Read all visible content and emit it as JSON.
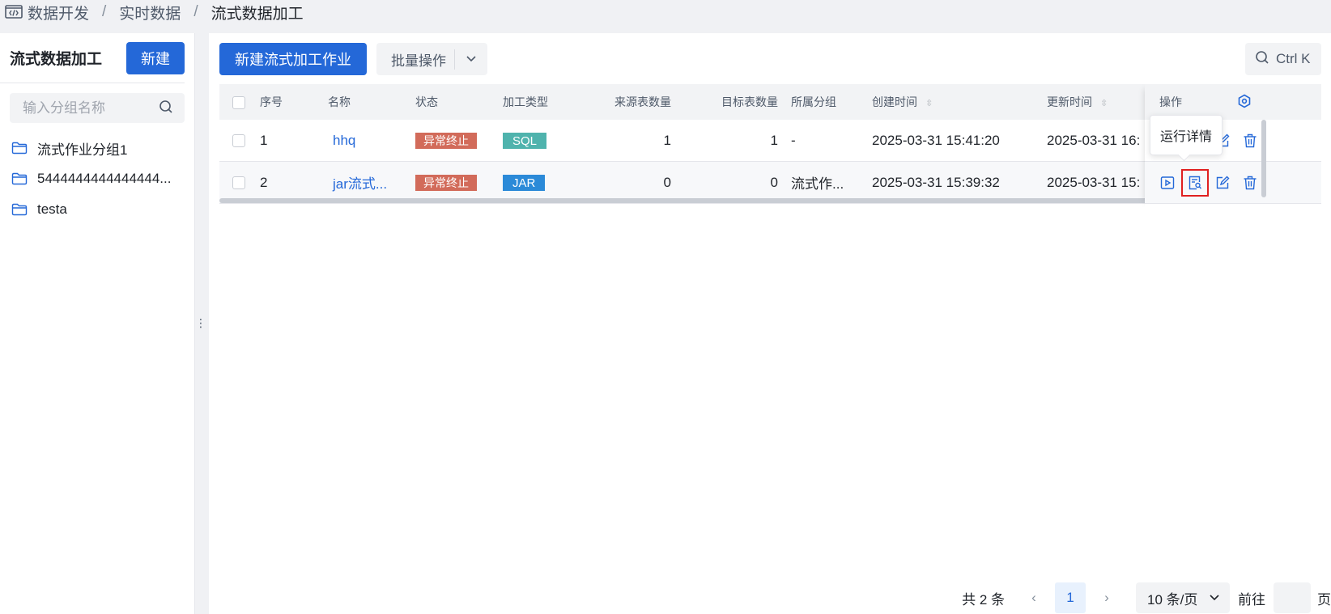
{
  "breadcrumb": {
    "items": [
      "数据开发",
      "实时数据",
      "流式数据加工"
    ],
    "separator": "/"
  },
  "sidebar": {
    "title": "流式数据加工",
    "new_label": "新建",
    "search_placeholder": "输入分组名称",
    "groups": [
      {
        "label": "流式作业分组1"
      },
      {
        "label": "5444444444444444..."
      },
      {
        "label": "testa"
      }
    ]
  },
  "toolbar": {
    "new_job_label": "新建流式加工作业",
    "batch_label": "批量操作",
    "shortcut_label": "Ctrl K"
  },
  "table": {
    "headers": {
      "index": "序号",
      "name": "名称",
      "status": "状态",
      "type": "加工类型",
      "source_count": "来源表数量",
      "target_count": "目标表数量",
      "group": "所属分组",
      "created": "创建时间",
      "updated": "更新时间",
      "ops": "操作"
    },
    "rows": [
      {
        "index": "1",
        "name": "hhq",
        "status": "异常终止",
        "type": "SQL",
        "source_count": "1",
        "target_count": "1",
        "group": "-",
        "created": "2025-03-31 15:41:20",
        "updated": "2025-03-31 16:"
      },
      {
        "index": "2",
        "name": "jar流式...",
        "status": "异常终止",
        "type": "JAR",
        "source_count": "0",
        "target_count": "0",
        "group": "流式作...",
        "created": "2025-03-31 15:39:32",
        "updated": "2025-03-31 15:"
      }
    ]
  },
  "tooltip": {
    "text": "运行详情"
  },
  "pagination": {
    "total": "共 2 条",
    "current_page": "1",
    "page_size": "10 条/页",
    "goto_label": "前往",
    "page_unit": "页"
  },
  "colors": {
    "primary": "#2468d8",
    "status_error": "#d26b5a",
    "tag_sql": "#4fb3ad",
    "tag_jar": "#2b8ad8",
    "highlight": "#e02020"
  }
}
